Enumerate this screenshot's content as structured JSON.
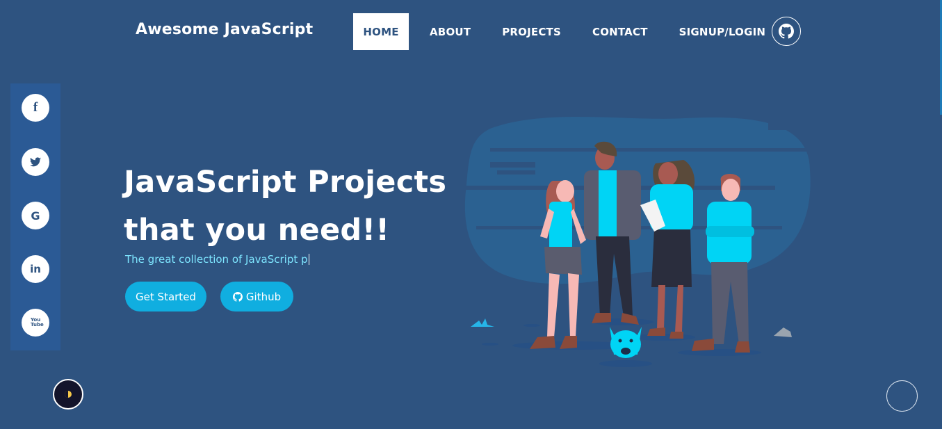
{
  "brand": "Awesome JavaScript",
  "nav": {
    "items": [
      {
        "label": "HOME"
      },
      {
        "label": "ABOUT"
      },
      {
        "label": "PROJECTS"
      },
      {
        "label": "CONTACT"
      },
      {
        "label": "SIGNUP/LOGIN"
      }
    ],
    "github_icon": "github-icon"
  },
  "social": {
    "items": [
      {
        "label": "f",
        "icon": "facebook-icon"
      },
      {
        "label": "",
        "icon": "twitter-icon"
      },
      {
        "label": "G",
        "icon": "google-icon"
      },
      {
        "label": "in",
        "icon": "linkedin-icon"
      },
      {
        "label": "You Tube",
        "icon": "youtube-icon"
      }
    ]
  },
  "hero": {
    "title_line1": "JavaScript Projects",
    "title_line2": "that you need!!",
    "subtitle": "The great collection of JavaScript p",
    "btn_start": "Get Started",
    "btn_github": "Github"
  },
  "colors": {
    "background": "#2e5380",
    "accent": "#10aee0",
    "sidebar": "#2b5a95",
    "subtitle": "#7ee6ff"
  }
}
